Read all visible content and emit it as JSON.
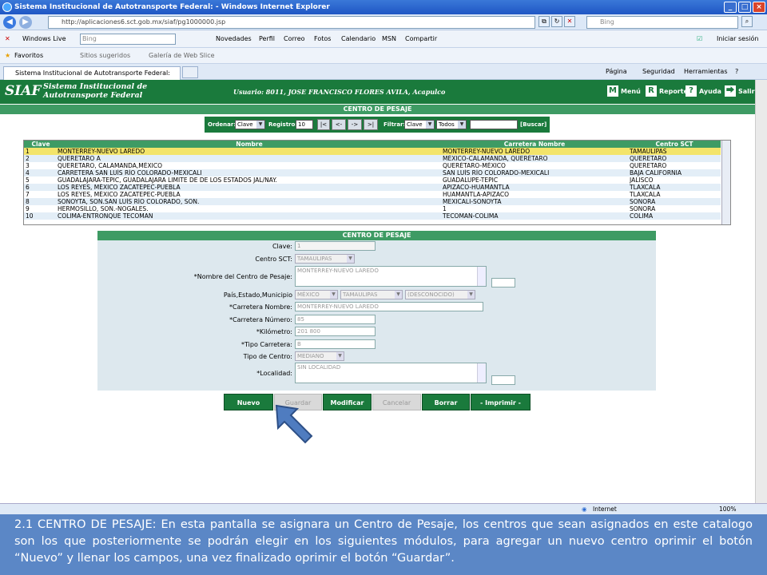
{
  "browser": {
    "title": "Sistema Institucional de Autotransporte Federal: - Windows Internet Explorer",
    "url": "http://aplicaciones6.sct.gob.mx/siaf/pg1000000.jsp",
    "search_placeholder": "Bing",
    "links": {
      "windows_live": "Windows Live",
      "bing_box": "Bing",
      "items": [
        "Novedades",
        "Perfil",
        "Correo",
        "Fotos",
        "Calendario",
        "MSN",
        "Compartir"
      ],
      "signin": "Iniciar sesión"
    },
    "favorites": {
      "label": "Favoritos",
      "suggested": "Sitios sugeridos",
      "gallery": "Galería de Web Slice"
    },
    "tab_title": "Sistema Institucional de Autotransporte Federal:",
    "commands": [
      "Página",
      "Seguridad",
      "Herramientas"
    ],
    "status": {
      "zone": "Internet",
      "zoom": "100%"
    }
  },
  "siaf": {
    "logo": "SIAF",
    "subtitle_line1": "Sistema Institucional de",
    "subtitle_line2": "Autotransporte Federal",
    "user": "Usuario: 8011, JOSE FRANCISCO FLORES AVILA, Acapulco",
    "menu": [
      {
        "icon": "M",
        "label": "Menú"
      },
      {
        "icon": "R",
        "label": "Reporte"
      },
      {
        "icon": "?",
        "label": "Ayuda"
      },
      {
        "icon": "⮕",
        "label": "Salir"
      }
    ]
  },
  "list": {
    "title": "CENTRO DE PESAJE",
    "filter": {
      "order_label": "Ordenar:",
      "order_value": "Clave",
      "records_label": "Registros:",
      "records_value": "10",
      "nav": [
        "|<",
        "<-",
        "->",
        ">|"
      ],
      "filter_label": "Filtrar:",
      "filter_field": "Clave",
      "filter_scope": "Todos",
      "search_label": "[Buscar]"
    },
    "columns": [
      "Clave",
      "Nombre",
      "Carretera Nombre",
      "Centro SCT"
    ],
    "rows": [
      [
        "1",
        "MONTERREY-NUEVO LAREDO",
        "MONTERREY-NUEVO LAREDO",
        "TAMAULIPAS"
      ],
      [
        "2",
        "QUERETARO A",
        "MÉXICO-CALAMANDA, QUERÉTARO",
        "QUERETARO"
      ],
      [
        "3",
        "QUERETARO, CALAMANDA,MÉXICO",
        "QUERÉTARO-MÉXICO",
        "QUERETARO"
      ],
      [
        "4",
        "CARRETERA SAN LUÍS RÍO COLORADO-MEXICALI",
        "SAN LUÍS RÍO COLORADO-MEXICALI",
        "BAJA CALIFORNIA"
      ],
      [
        "5",
        "GUADALAJARA-TEPIC, GUADALAJARA LIMITE DE DE LOS ESTADOS JAL/NAY.",
        "GUADALUPE-TEPIC",
        "JALISCO"
      ],
      [
        "6",
        "LOS REYES, MÉXICO ZACATEPEC-PUEBLA",
        "APIZACO-HUAMANTLA",
        "TLAXCALA"
      ],
      [
        "7",
        "LOS REYES, MÉXICO ZACATEPEC-PUEBLA",
        "HUAMANTLA-APIZACO",
        "TLAXCALA"
      ],
      [
        "8",
        "SONOYTA, SON.SAN LUÍS RÍO COLORADO, SON.",
        "MEXICALI-SONOYTA",
        "SONORA"
      ],
      [
        "9",
        "HERMOSILLO, SON.-NOGALES.",
        "1",
        "SONORA"
      ],
      [
        "10",
        "COLIMA-ENTRONQUE TECOMAN",
        "TECOMAN-COLIMA",
        "COLIMA"
      ]
    ]
  },
  "form": {
    "title": "CENTRO DE PESAJE",
    "clave_label": "Clave:",
    "clave_value": "1",
    "centro_sct_label": "Centro SCT:",
    "centro_sct_value": "TAMAULIPAS",
    "nombre_label": "*Nombre del Centro de Pesaje:",
    "nombre_value": "MONTERREY-NUEVO LAREDO",
    "pais_label": "País,Estado,Municipio",
    "pais_value": "MÉXICO",
    "estado_value": "TAMAULIPAS",
    "municipio_value": "(DESCONOCIDO)",
    "carretera_nombre_label": "*Carretera Nombre:",
    "carretera_nombre_value": "MONTERREY-NUEVO LAREDO",
    "carretera_numero_label": "*Carretera Número:",
    "carretera_numero_value": "85",
    "kilometro_label": "*Kilómetro:",
    "kilometro_value": "201 800",
    "tipo_carretera_label": "*Tipo Carretera:",
    "tipo_carretera_value": "B",
    "tipo_centro_label": "Tipo de Centro:",
    "tipo_centro_value": "MEDIANO",
    "localidad_label": "*Localidad:",
    "localidad_value": "SIN LOCALIDAD"
  },
  "actions": {
    "nuevo": "Nuevo",
    "guardar": "Guardar",
    "modificar": "Modificar",
    "cancelar": "Cancelar",
    "borrar": "Borrar",
    "imprimir": "- Imprimir -"
  },
  "caption": "2.1 CENTRO DE PESAJE: En esta pantalla se asignara un Centro de Pesaje, los centros que sean asignados en este catalogo son los que posteriormente se podrán elegir en los siguientes módulos, para agregar un nuevo centro oprimir el botón “Nuevo” y llenar los campos, una vez finalizado oprimir el botón “Guardar”.",
  "colors": {
    "accent": "#1a7a3c",
    "header": "#3e9b64",
    "selected_row": "#f3e46a",
    "caption_bg": "#5b87c6"
  }
}
